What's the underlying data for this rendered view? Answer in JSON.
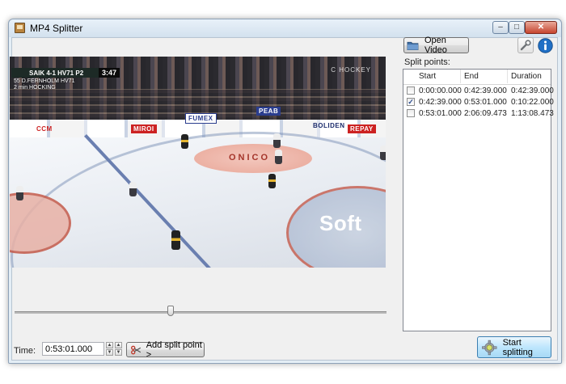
{
  "window": {
    "title": "MP4 Splitter",
    "minimize_glyph": "–",
    "maximize_glyph": "□",
    "close_glyph": "✕"
  },
  "video": {
    "scoreboard": {
      "teams": "SAIK  4-1  HV71  P2",
      "clock": "3:47"
    },
    "penalty_lines": [
      "55  D.FERNHOLM  HV71",
      "2 min  HOCKING"
    ],
    "watermark": "C HOCKEY",
    "ads": [
      "FUMEX",
      "CCM",
      "MIROI",
      "PEAB",
      "BOLIDEN",
      "REPAY",
      "ONICO",
      "Soft"
    ]
  },
  "seek": {
    "position_fraction": 0.42
  },
  "controls": {
    "time_label": "Time:",
    "time_value": "0:53:01.000",
    "add_split_label": "Add split point >",
    "start_label": "Start splitting"
  },
  "toolbar": {
    "open_video_label": "Open Video"
  },
  "split_points": {
    "label": "Split points:",
    "columns": [
      "Start",
      "End",
      "Duration"
    ],
    "rows": [
      {
        "checked": false,
        "check_glyph": "",
        "start": "0:00:00.000",
        "end": "0:42:39.000",
        "duration": "0:42:39.000"
      },
      {
        "checked": true,
        "check_glyph": "✓",
        "start": "0:42:39.000",
        "end": "0:53:01.000",
        "duration": "0:10:22.000"
      },
      {
        "checked": false,
        "check_glyph": "",
        "start": "0:53:01.000",
        "end": "2:06:09.473",
        "duration": "1:13:08.473"
      }
    ]
  },
  "colors": {
    "accent": "#3c7fb1",
    "info": "#1f6fc5",
    "scissors": "#c0392b",
    "title_bg": "#dbe7f2"
  },
  "icons": [
    "app-icon",
    "folder-icon",
    "wrench-icon",
    "info-icon",
    "scissors-icon",
    "gear-icon"
  ]
}
